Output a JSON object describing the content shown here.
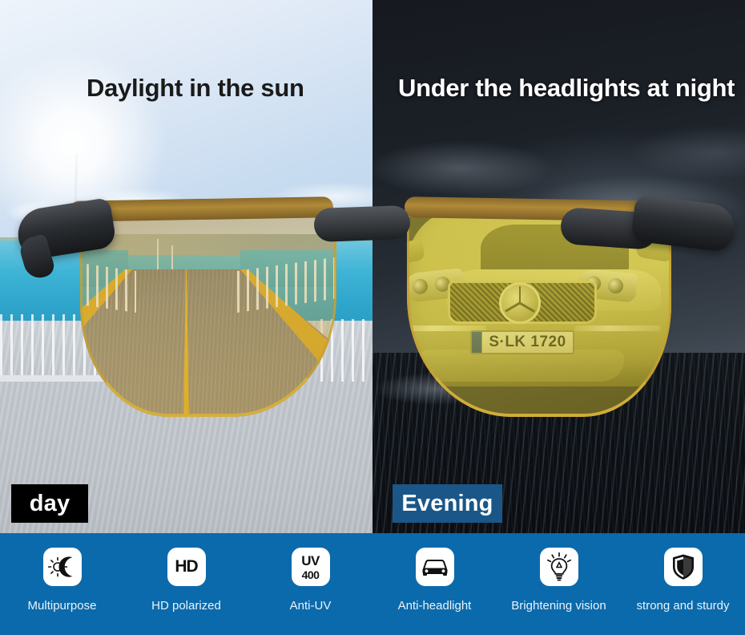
{
  "panels": {
    "day": {
      "heading": "Daylight in the sun",
      "badge": "day",
      "badge_bg": "#000000",
      "scene": "bridge-road-daytime"
    },
    "night": {
      "heading": "Under the headlights at night",
      "badge": "Evening",
      "badge_bg": "#1a5788",
      "scene": "car-headlights-night",
      "license_plate": "S·LK 1720"
    }
  },
  "feature_bar": {
    "background": "#0b6aab",
    "items": [
      {
        "icon": "sun-moon-icon",
        "label": "Multipurpose"
      },
      {
        "icon": "hd-icon",
        "label": "HD polarized",
        "icon_text": "HD"
      },
      {
        "icon": "uv400-icon",
        "label": "Anti-UV",
        "icon_text_top": "UV",
        "icon_text_bottom": "400"
      },
      {
        "icon": "car-icon",
        "label": "Anti-headlight"
      },
      {
        "icon": "lightbulb-icon",
        "label": "Brightening vision"
      },
      {
        "icon": "shield-icon",
        "label": "strong and sturdy"
      }
    ]
  },
  "colors": {
    "accent_blue": "#0b6aab",
    "badge_blue": "#1a5788",
    "lens_gold": "#d6b03c"
  }
}
